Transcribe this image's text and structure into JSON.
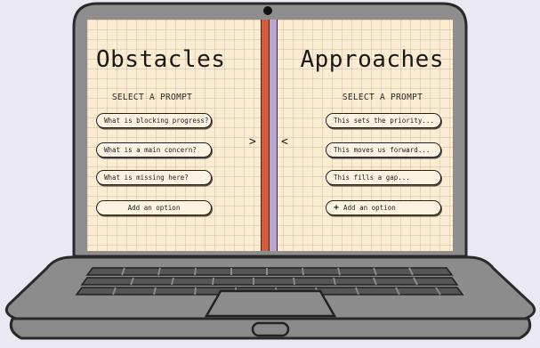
{
  "left_panel": {
    "title": "Obstacles",
    "subheading": "SELECT A PROMPT",
    "prompts": [
      "What is blocking progress?",
      "What is a main concern?",
      "What is missing here?"
    ],
    "add_option": "Add an option"
  },
  "right_panel": {
    "title": "Approaches",
    "subheading": "SELECT A PROMPT",
    "prompts": [
      "This sets the priority...",
      "This moves us forward...",
      "This fills a gap..."
    ],
    "add_option": "Add an option"
  },
  "arrows": {
    "left": ">",
    "right": "<"
  },
  "icons": {
    "add": "plus-icon",
    "camera": "camera-dot-icon"
  },
  "colors": {
    "screen_bg": "#fcecd2",
    "laptop_body": "#8e8e8e",
    "laptop_outline": "#2a2a2a",
    "divider_red": "#d65a3c",
    "divider_purple": "#b9a6d4",
    "page_bg": "#eae8f3"
  }
}
